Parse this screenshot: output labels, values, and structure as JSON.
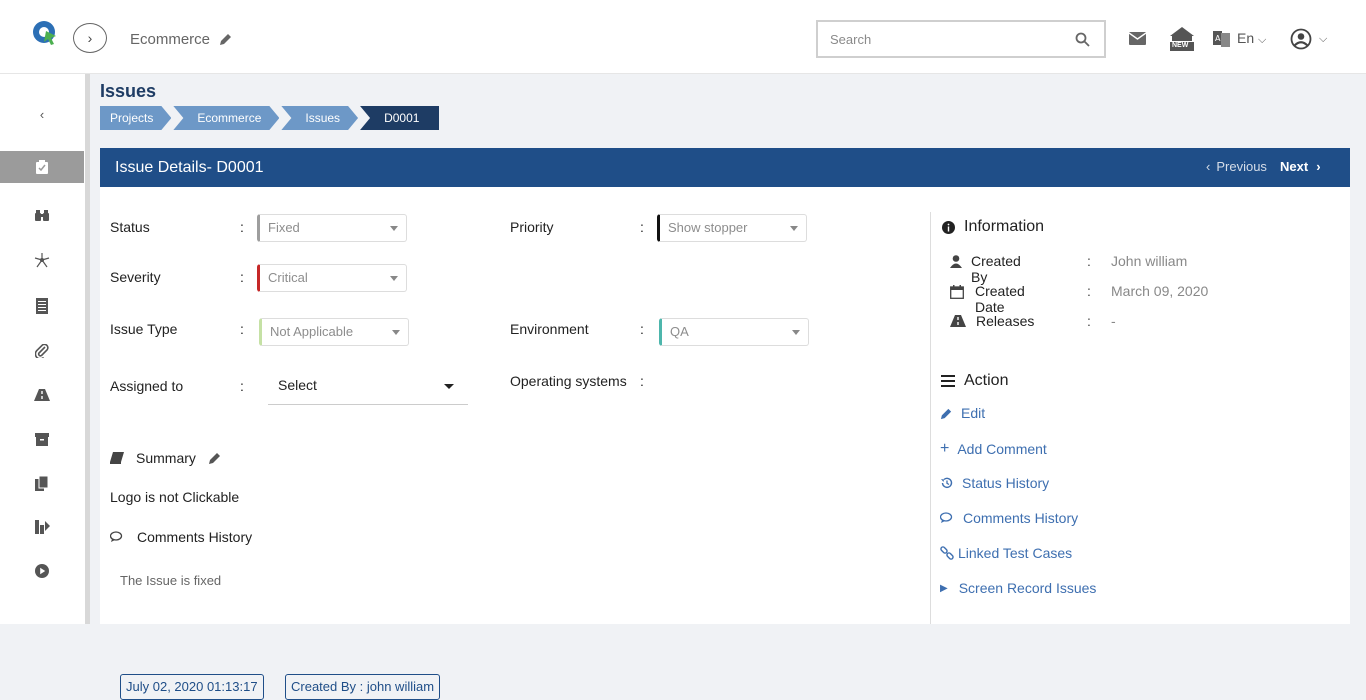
{
  "header": {
    "project_name": "Ecommerce",
    "search_placeholder": "Search",
    "language": "En",
    "badge_new": "NEW"
  },
  "page": {
    "title": "Issues",
    "breadcrumb": [
      "Projects",
      "Ecommerce",
      "Issues",
      "D0001"
    ]
  },
  "panel": {
    "title": "Issue Details- D0001",
    "previous_label": "Previous",
    "next_label": "Next"
  },
  "fields": {
    "status": {
      "label": "Status",
      "value": "Fixed",
      "accent": "#9e9e9e"
    },
    "severity": {
      "label": "Severity",
      "value": "Critical",
      "accent": "#c62828"
    },
    "issue_type": {
      "label": "Issue Type",
      "value": "Not Applicable",
      "accent": "#c5e1a5"
    },
    "assigned_to": {
      "label": "Assigned to",
      "value": "Select"
    },
    "priority": {
      "label": "Priority",
      "value": "Show stopper",
      "accent": "#111111"
    },
    "environment": {
      "label": "Environment",
      "value": "QA",
      "accent": "#4db6ac"
    },
    "operating_systems": {
      "label": "Operating systems"
    }
  },
  "colon": ":",
  "summary": {
    "heading": "Summary",
    "text": "Logo is not Clickable"
  },
  "comments": {
    "heading": "Comments History",
    "text": "The Issue is fixed",
    "date": "July 02, 2020 01:13:17",
    "created_by": "Created By : john william"
  },
  "information": {
    "heading": "Information",
    "rows": [
      {
        "key": "Created By",
        "value": "John william"
      },
      {
        "key": "Created Date",
        "value": "March 09, 2020"
      },
      {
        "key": "Releases",
        "value": "-"
      }
    ]
  },
  "actions": {
    "heading": "Action",
    "items": [
      "Edit",
      "Add Comment",
      "Status History",
      "Comments History",
      "Linked Test Cases",
      "Screen Record Issues"
    ]
  },
  "colors": {
    "primary": "#1f4e88",
    "breadcrumb": "#6d98c7",
    "link": "#3e6fb0"
  }
}
